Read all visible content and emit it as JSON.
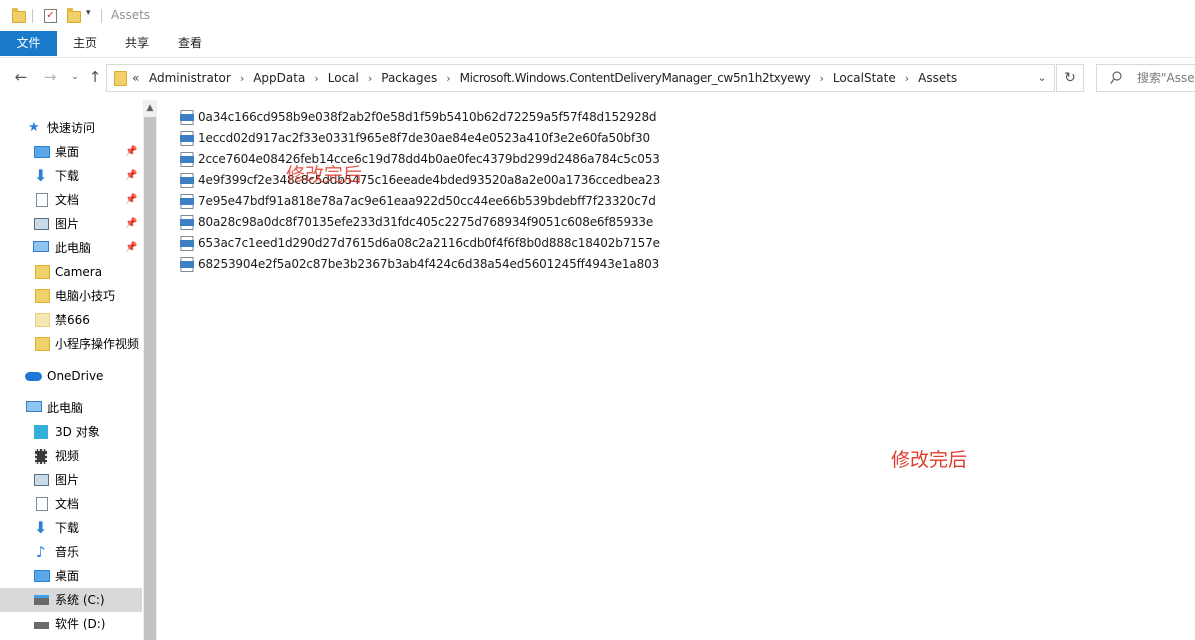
{
  "window": {
    "title": "Assets"
  },
  "ribbon": {
    "tabs": [
      "文件",
      "主页",
      "共享",
      "查看"
    ]
  },
  "address": {
    "overflow_glyph": "«",
    "crumbs": [
      "Administrator",
      "AppData",
      "Local",
      "Packages",
      "Microsoft.Windows.ContentDeliveryManager_cw5n1h2txyewy",
      "LocalState",
      "Assets"
    ]
  },
  "search": {
    "placeholder": "搜索\"Assets\""
  },
  "nav": {
    "quick_access": "快速访问",
    "desktop": "桌面",
    "downloads": "下载",
    "documents": "文档",
    "pictures": "图片",
    "this_pc_pinned": "此电脑",
    "camera": "Camera",
    "tips": "电脑小技巧",
    "jin666": "禁666",
    "miniprogram": "小程序操作视频",
    "onedrive": "OneDrive",
    "this_pc": "此电脑",
    "objects3d": "3D 对象",
    "videos": "视频",
    "pictures2": "图片",
    "documents2": "文档",
    "downloads2": "下载",
    "music": "音乐",
    "desktop2": "桌面",
    "drive_c": "系统 (C:)",
    "drive_d": "软件 (D:)"
  },
  "files": [
    "0a34c166cd958b9e038f2ab2f0e58d1f59b5410b62d72259a5f57f48d152928d",
    "1eccd02d917ac2f33e0331f965e8f7de30ae84e4e0523a410f3e2e60fa50bf30",
    "2cce7604e08426feb14cce6c19d78dd4b0ae0fec4379bd299d2486a784c5c053",
    "4e9f399cf2e348c8c5ddb5475c16eeade4bded93520a8a2e00a1736ccedbea23",
    "7e95e47bdf91a818e78a7ac9e61eaa922d50cc44ee66b539bdebff7f23320c7d",
    "80a28c98a0dc8f70135efe233d31fdc405c2275d768934f9051c608e6f85933e",
    "653ac7c1eed1d290d27d7615d6a08c2a2116cdb0f4f6f8b0d888c18402b7157e",
    "68253904e2f5a02c87be3b2367b3ab4f424c6d38a54ed5601245ff4943e1a803"
  ],
  "overlays": {
    "label_1": "修改完后",
    "label_2": "修改完后"
  },
  "colors": {
    "accent": "#1979ca",
    "overlay_red": "#e03c2c",
    "selected_bg": "#d9d9d9"
  }
}
